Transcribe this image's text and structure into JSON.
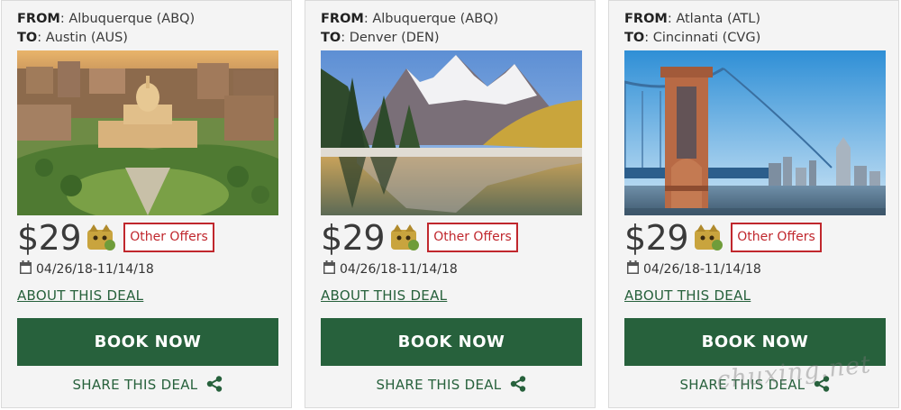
{
  "labels": {
    "from": "FROM",
    "to": "TO"
  },
  "cards": [
    {
      "from": "Albuquerque (ABQ)",
      "to": "Austin (AUS)",
      "price": "$29",
      "offers_label": "Other Offers",
      "dates": "04/26/18-11/14/18",
      "about_label": "ABOUT THIS DEAL",
      "book_label": "BOOK NOW",
      "share_label": "SHARE THIS DEAL"
    },
    {
      "from": "Albuquerque (ABQ)",
      "to": "Denver (DEN)",
      "price": "$29",
      "offers_label": "Other Offers",
      "dates": "04/26/18-11/14/18",
      "about_label": "ABOUT THIS DEAL",
      "book_label": "BOOK NOW",
      "share_label": "SHARE THIS DEAL"
    },
    {
      "from": "Atlanta (ATL)",
      "to": "Cincinnati (CVG)",
      "price": "$29",
      "offers_label": "Other Offers",
      "dates": "04/26/18-11/14/18",
      "about_label": "ABOUT THIS DEAL",
      "book_label": "BOOK NOW",
      "share_label": "SHARE THIS DEAL"
    }
  ],
  "watermark": "chuxing.net",
  "icons": [
    "calendar-icon",
    "share-icon",
    "mascot-icon"
  ],
  "colors": {
    "brand_green": "#27613c",
    "offer_red": "#c0272d"
  }
}
